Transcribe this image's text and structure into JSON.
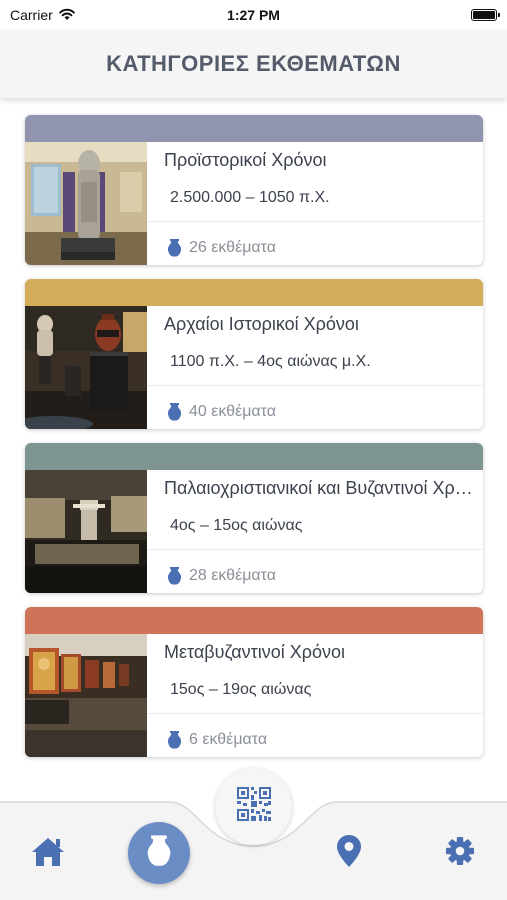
{
  "status_bar": {
    "carrier": "Carrier",
    "time": "1:27 PM"
  },
  "header": {
    "title": "ΚΑΤΗΓΟΡΙΕΣ ΕΚΘΕΜΑΤΩΝ"
  },
  "categories": [
    {
      "title": "Προϊστορικοί Χρόνοι",
      "period": "2.500.000 – 1050 π.Χ.",
      "count": "26 εκθέματα",
      "color": "#9094ae"
    },
    {
      "title": "Αρχαίοι Ιστορικοί Χρόνοι",
      "period": "1100 π.Χ. – 4ος αιώνας μ.Χ.",
      "count": "40 εκθέματα",
      "color": "#d4ad5a"
    },
    {
      "title": "Παλαιοχριστιανικοί και Βυζαντινοί Χρόνοι",
      "period": "4ος – 15ος αιώνας",
      "count": "28 εκθέματα",
      "color": "#7e9490"
    },
    {
      "title": "Μεταβυζαντινοί Χρόνοι",
      "period": "15ος – 19ος αιώνας",
      "count": "6 εκθέματα",
      "color": "#cf7458"
    }
  ],
  "nav": {
    "icons": [
      "home-icon",
      "vase-icon",
      "qr-code-icon",
      "location-pin-icon",
      "gear-icon"
    ],
    "accent": "#4a6fb3"
  }
}
